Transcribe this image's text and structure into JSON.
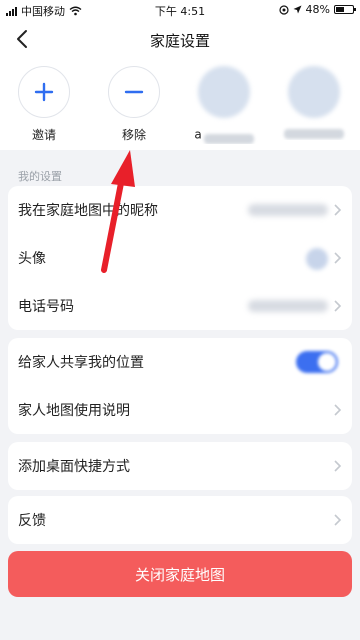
{
  "status_bar": {
    "carrier": "中国移动",
    "time": "下午 4:51",
    "battery": "48%"
  },
  "header": {
    "title": "家庭设置"
  },
  "members": [
    {
      "name": "邀请",
      "icon": "plus-icon",
      "type": "action"
    },
    {
      "name": "移除",
      "icon": "minus-icon",
      "type": "action"
    },
    {
      "name": "a",
      "type": "blurred-avatar"
    },
    {
      "name": "",
      "type": "blurred-avatar"
    }
  ],
  "section_title": "我的设置",
  "settings": [
    {
      "label": "我在家庭地图中的昵称"
    },
    {
      "label": "头像"
    },
    {
      "label": "电话号码"
    }
  ],
  "sharing": [
    {
      "label": "给家人共享我的位置",
      "control": "toggle",
      "toggle_on": true
    },
    {
      "label": "家人地图使用说明"
    }
  ],
  "shortcut": {
    "label": "添加桌面快捷方式"
  },
  "feedback": {
    "label": "反馈"
  },
  "close_button": {
    "label": "关闭家庭地图"
  },
  "colors": {
    "accent": "#2f6df0",
    "danger": "#f45c5c",
    "annotation_arrow": "#e8202a",
    "background": "#f2f3f6"
  }
}
